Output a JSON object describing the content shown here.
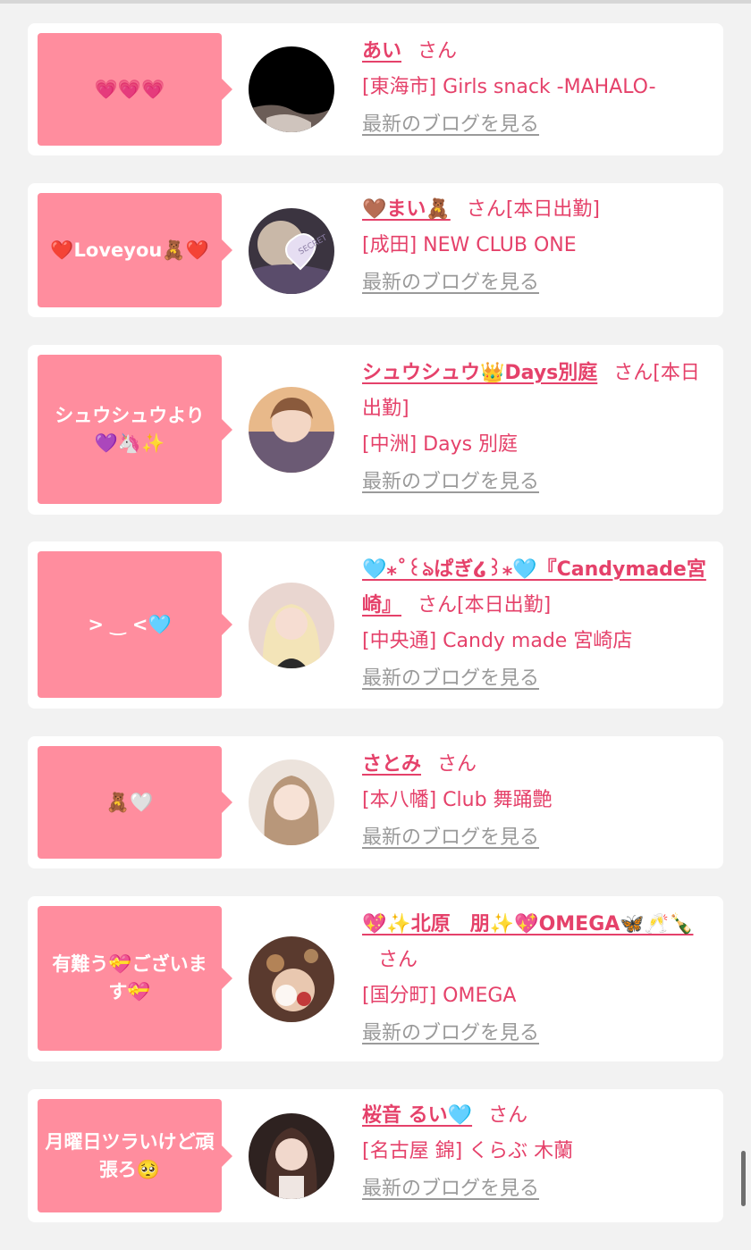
{
  "san_label": "さん",
  "blog_link": "最新のブログを見る",
  "cards": [
    {
      "message": "💗💗💗",
      "name": "あい",
      "suffix": "",
      "shop": "[東海市] Girls snack -MAHALO-",
      "avatar": "avatar-black"
    },
    {
      "message": "❤️Loveyou🧸❤️",
      "name": "🤎まい🧸",
      "suffix": "[本日出勤]",
      "shop": "[成田] NEW CLUB ONE",
      "avatar": "avatar-secret"
    },
    {
      "message": "シュウシュウより💜🦄✨",
      "name": "シュウシュウ👑Days別庭",
      "suffix": "[本日出勤]",
      "shop": "[中洲] Days 別庭",
      "avatar": "avatar-sunset"
    },
    {
      "message": "> ‿ <🩵",
      "name": "🩵⁎˚꒰ঌぱぎ໒꒱⁎🩵『Candymade宮崎』",
      "suffix": "[本日出勤]",
      "shop": "[中央通] Candy made 宮崎店",
      "avatar": "avatar-blonde"
    },
    {
      "message": "🧸🤍",
      "name": "さとみ",
      "suffix": "",
      "shop": "[本八幡] Club 舞踊艶",
      "avatar": "avatar-light"
    },
    {
      "message": "有難う💝ございます💝",
      "name": "💖✨北原　朋✨💖OMEGA🦋🥂🍾",
      "suffix": "",
      "shop": "[国分町] OMEGA",
      "avatar": "avatar-flower"
    },
    {
      "message": "月曜日ツラいけど頑張ろ🥺",
      "name": "桜音 るい🩵",
      "suffix": "",
      "shop": "[名古屋 錦] くらぶ 木蘭",
      "avatar": "avatar-dark"
    }
  ],
  "colors": {
    "background": "#f2f2f2",
    "bubble": "#ff8d9e",
    "accent_text": "#e5416a",
    "link_gray": "#9a9a9a"
  }
}
